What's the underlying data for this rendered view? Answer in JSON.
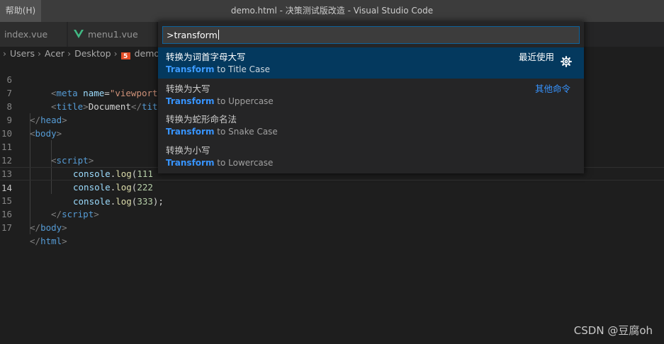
{
  "titlebar": {
    "menu_help": "帮助(H)",
    "window_title": "demo.html - 决策测试版改造 - Visual Studio Code"
  },
  "tabs": [
    {
      "label": "index.vue"
    },
    {
      "label": "menu1.vue",
      "icon": "vue-icon"
    }
  ],
  "breadcrumb": {
    "items": [
      "Users",
      "Acer",
      "Desktop",
      "demo"
    ],
    "file_icon": "html5-icon"
  },
  "editor": {
    "line_numbers": [
      "6",
      "7",
      "8",
      "9",
      "10",
      "11",
      "12",
      "13",
      "14",
      "15",
      "16",
      "17"
    ],
    "active_line": "14",
    "lines": {
      "l6": {
        "open": "<",
        "tag": "meta",
        "attr": "name",
        "eq": "=",
        "val": "\"viewport"
      },
      "l7": {
        "open": "<",
        "tag": "title",
        "close": ">",
        "text": "Document",
        "open2": "</",
        "tag2": "tit"
      },
      "l8": {
        "open": "</",
        "tag": "head",
        "close": ">"
      },
      "l9": {
        "open": "<",
        "tag": "body",
        "close": ">"
      },
      "l11": {
        "open": "<",
        "tag": "script",
        "close": ">"
      },
      "l12": {
        "obj": "console",
        "dot": ".",
        "fn": "log",
        "paren": "(",
        "num": "111"
      },
      "l13": {
        "obj": "console",
        "dot": ".",
        "fn": "log",
        "paren": "(",
        "num": "222"
      },
      "l14": {
        "obj": "console",
        "dot": ".",
        "fn": "log",
        "paren": "(",
        "num": "333",
        "tail": ");"
      },
      "l15": {
        "open": "</",
        "tag": "script",
        "close": ">"
      },
      "l16": {
        "open": "</",
        "tag": "body",
        "close": ">"
      },
      "l17": {
        "open": "</",
        "tag": "html",
        "close": ">"
      }
    }
  },
  "palette": {
    "query": ">transform",
    "items": [
      {
        "title": "转换为词首字母大写",
        "match": "Transform",
        "rest": " to Title Case",
        "group": "最近使用",
        "selected": true
      },
      {
        "title": "转换为大写",
        "match": "Transform",
        "rest": " to Uppercase",
        "group": "其他命令"
      },
      {
        "title": "转换为蛇形命名法",
        "match": "Transform",
        "rest": " to Snake Case"
      },
      {
        "title": "转换为小写",
        "match": "Transform",
        "rest": " to Lowercase"
      }
    ],
    "gear_icon": "gear-icon"
  },
  "watermark": "CSDN @豆腐oh",
  "colors": {
    "accent": "#0e639c",
    "selection": "#04395e",
    "highlight": "#3794ff",
    "html_tag": "#569cd6",
    "attr_name": "#9cdcfe",
    "string": "#ce9178",
    "function": "#dcdcaa",
    "number": "#b5cea8"
  }
}
